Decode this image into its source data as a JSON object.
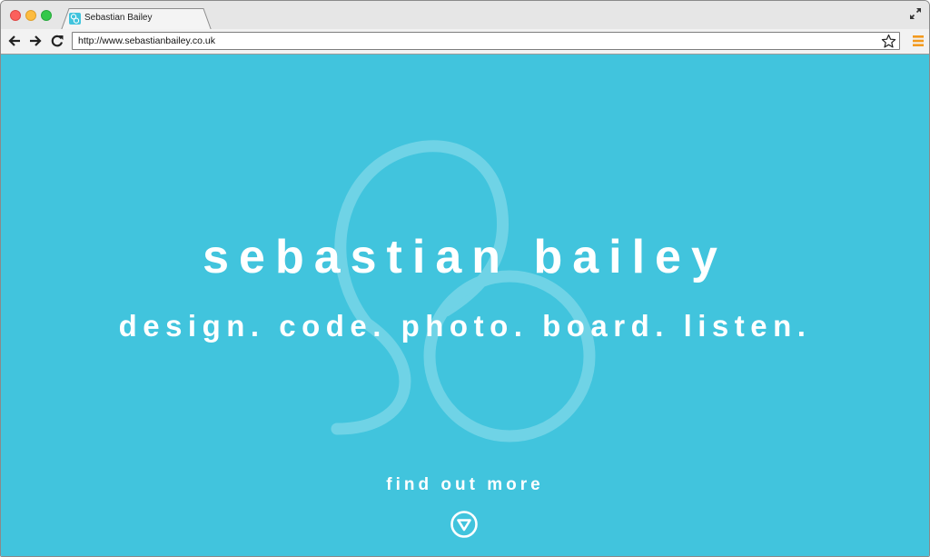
{
  "browser": {
    "tab": {
      "title": "Sebastian Bailey",
      "favicon": "sb-logo-icon"
    },
    "address_bar": {
      "url": "http://www.sebastianbailey.co.uk"
    },
    "icons": {
      "back": "arrow-left-icon",
      "forward": "arrow-right-icon",
      "reload": "reload-icon",
      "bookmark": "star-icon",
      "menu": "hamburger-menu-icon",
      "fullscreen": "expand-icon"
    }
  },
  "page": {
    "title": "sebastian bailey",
    "tagline": "design. code. photo. board. listen.",
    "cta": "find out more",
    "colors": {
      "background": "#41c4dd",
      "text": "#ffffff",
      "logo_stroke": "#6fd3e6",
      "menu_accent": "#f39a1e"
    }
  }
}
